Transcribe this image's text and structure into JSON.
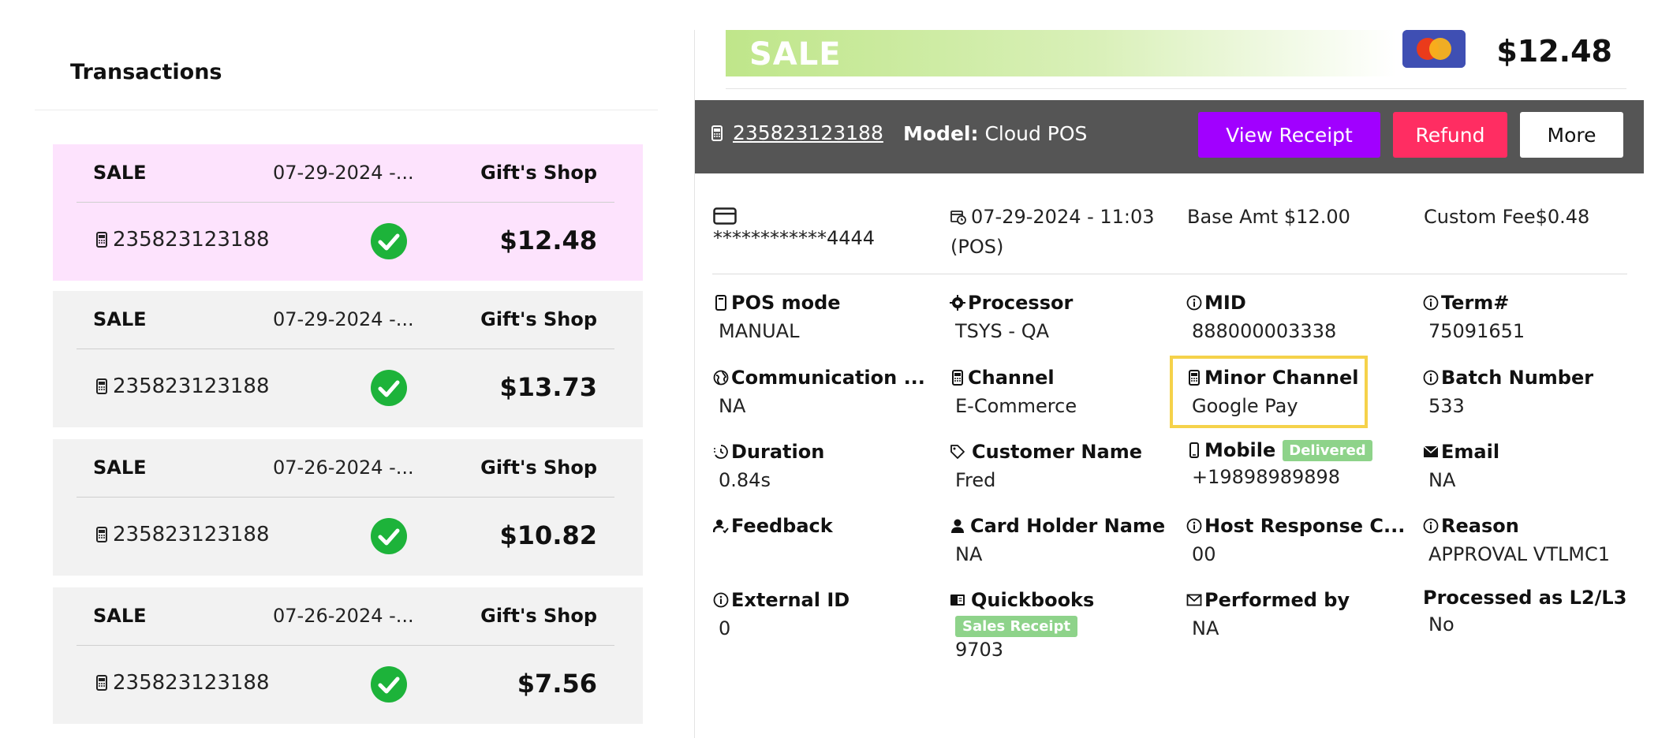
{
  "left": {
    "title": "Transactions",
    "cards": [
      {
        "type": "SALE",
        "date": "07-29-2024 -...",
        "shop": "Gift's Shop",
        "txn": "235823123188",
        "amount": "$12.48"
      },
      {
        "type": "SALE",
        "date": "07-29-2024 -...",
        "shop": "Gift's Shop",
        "txn": "235823123188",
        "amount": "$13.73"
      },
      {
        "type": "SALE",
        "date": "07-26-2024 -...",
        "shop": "Gift's Shop",
        "txn": "235823123188",
        "amount": "$10.82"
      },
      {
        "type": "SALE",
        "date": "07-26-2024 -...",
        "shop": "Gift's Shop",
        "txn": "235823123188",
        "amount": "$7.56"
      }
    ]
  },
  "header": {
    "sale_label": "SALE",
    "amount": "$12.48"
  },
  "toolbar": {
    "txn_id": "235823123188",
    "model_label": "Model:",
    "model_value": "Cloud POS",
    "view_receipt": "View Receipt",
    "refund": "Refund",
    "more": "More"
  },
  "summary": {
    "card_number": "************4444",
    "datetime_line1": "07-29-2024 - 11:03",
    "datetime_line2": "(POS)",
    "base_amt": "Base Amt $12.00",
    "custom_fee": "Custom Fee$0.48"
  },
  "fields": {
    "pos_mode": {
      "label": "POS mode",
      "value": "MANUAL"
    },
    "processor": {
      "label": "Processor",
      "value": "TSYS - QA"
    },
    "mid": {
      "label": "MID",
      "value": "888000003338"
    },
    "term": {
      "label": "Term#",
      "value": "75091651"
    },
    "communication": {
      "label": "Communication ...",
      "value": "NA"
    },
    "channel": {
      "label": "Channel",
      "value": "E-Commerce"
    },
    "minor_channel": {
      "label": "Minor Channel",
      "value": "Google Pay"
    },
    "batch": {
      "label": "Batch Number",
      "value": "533"
    },
    "duration": {
      "label": "Duration",
      "value": "0.84s"
    },
    "customer_name": {
      "label": "Customer Name",
      "value": "Fred"
    },
    "mobile": {
      "label": "Mobile",
      "badge": "Delivered",
      "value": "+19898989898"
    },
    "email": {
      "label": "Email",
      "value": "NA"
    },
    "feedback": {
      "label": "Feedback",
      "value": ""
    },
    "card_holder": {
      "label": "Card Holder Name",
      "value": "NA"
    },
    "host_response": {
      "label": "Host Response C...",
      "value": "00"
    },
    "reason": {
      "label": "Reason",
      "value": "APPROVAL VTLMC1"
    },
    "external_id": {
      "label": "External ID",
      "value": "0"
    },
    "quickbooks": {
      "label": "Quickbooks",
      "badge": "Sales Receipt",
      "value": "9703"
    },
    "performed_by": {
      "label": "Performed by",
      "value": "NA"
    },
    "processed_l2l3": {
      "label": "Processed as L2/L3",
      "value": "No"
    }
  },
  "colors": {
    "selected_card": "#fde3fd",
    "card": "#f2f2f2",
    "view_receipt": "#a100ff",
    "refund": "#ff2d62",
    "success": "#1db33a",
    "badge": "#8ed38a",
    "highlight": "#f5d24a"
  }
}
